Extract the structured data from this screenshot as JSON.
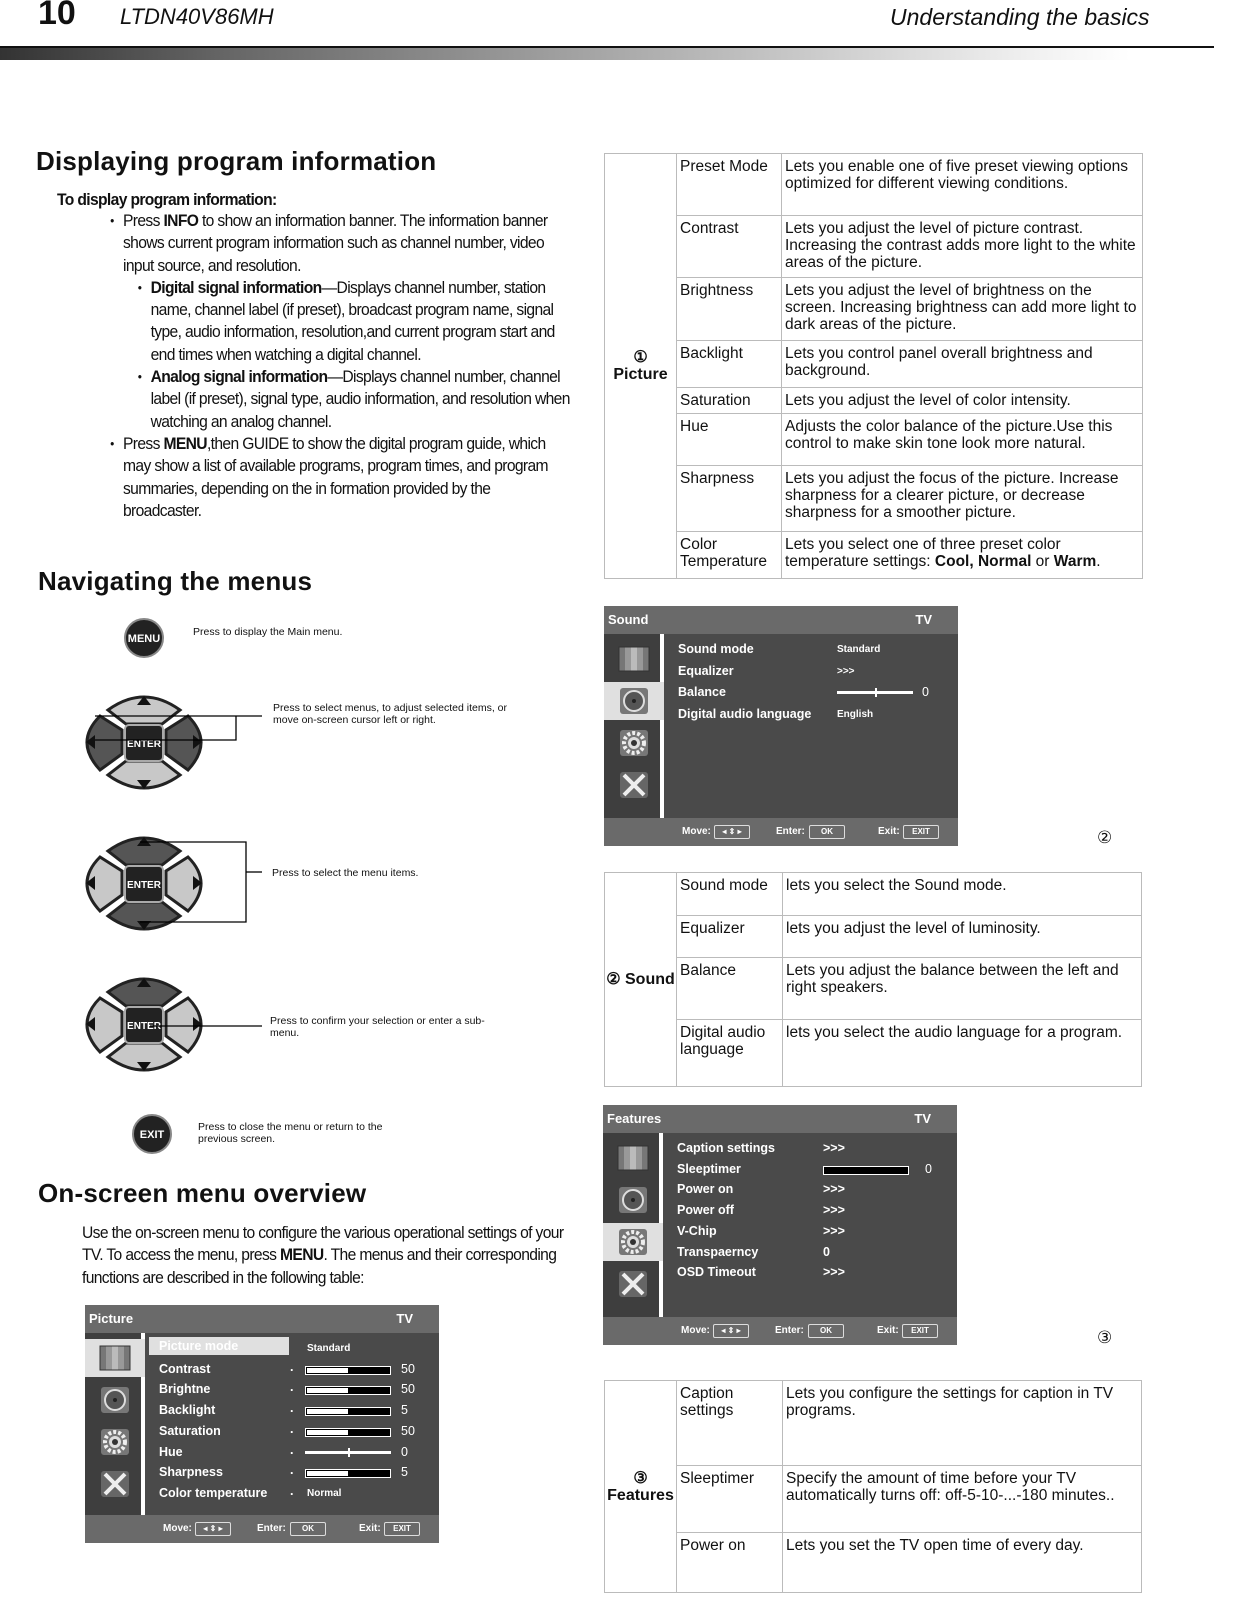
{
  "header": {
    "page_number": "10",
    "model": "LTDN40V86MH",
    "section": "Understanding the basics"
  },
  "display_info": {
    "title": "Displaying program information",
    "subtitle": "To display program information:",
    "bullets": [
      {
        "level": 1,
        "parts": [
          "Press ",
          {
            "b": "INFO"
          },
          " to show an information banner. The information banner shows current program information such as channel number, video input source, and resolution."
        ]
      },
      {
        "level": 2,
        "parts": [
          {
            "b": "Digital signal information"
          },
          "—Displays channel number, station name, channel label (if preset), broadcast program name, signal type, audio information, resolution,and current program start and end times when watching a digital channel."
        ]
      },
      {
        "level": 2,
        "parts": [
          {
            "b": "Analog signal information"
          },
          "—Displays channel number, channel label (if preset), signal type, audio information, and resolution when watching an analog channel."
        ]
      },
      {
        "level": 1,
        "parts": [
          "Press ",
          {
            "b": "MENU"
          },
          ",then GUIDE  to show the digital program guide, which may show a list of available programs, program times, and program summaries, depending on the in  formation provided by the broadcaster."
        ]
      }
    ]
  },
  "navigating": {
    "title": "Navigating the menus",
    "menu_btn": "MENU",
    "enter_btn": "ENTER",
    "exit_btn": "EXIT",
    "callouts": [
      "Press to display the Main menu.",
      "Press to select menus, to adjust selected items, or move on-screen cursor left or right.",
      "Press to select the menu items.",
      "Press to confirm your selection or enter a sub-menu.",
      "Press to close the menu or return to the previous screen."
    ]
  },
  "overview": {
    "title": "On-screen menu overview",
    "intro": [
      "Use the on-screen menu to configure the various operational settings of your TV. To access the menu, press ",
      {
        "b": "MENU"
      },
      ". The menus and their corresponding functions are described in the following table:"
    ]
  },
  "osd_common": {
    "tv": "TV",
    "move": "Move:",
    "enter": "Enter:",
    "exit": "Exit:",
    "move_key": "◂ ⇕ ▸",
    "ok_key": "OK",
    "exit_key": "EXIT"
  },
  "osd_picture": {
    "title": "Picture",
    "selected_index": 0,
    "rows": [
      {
        "label": "Picture mode",
        "value": "Standard"
      },
      {
        "label": "Contrast",
        "value": "50",
        "bar": 0.5
      },
      {
        "label": "Brightne",
        "value": "50",
        "bar": 0.5
      },
      {
        "label": "Backlight",
        "value": "5",
        "bar": 0.5
      },
      {
        "label": "Saturation",
        "value": "50",
        "bar": 0.5
      },
      {
        "label": "Hue",
        "value": "0",
        "slider": 0.5
      },
      {
        "label": "Sharpness",
        "value": "5",
        "bar": 0.5
      },
      {
        "label": "Color temperature",
        "value": "Normal"
      }
    ]
  },
  "osd_sound": {
    "title": "Sound",
    "selected_icon": 1,
    "rows": [
      {
        "label": "Sound mode",
        "value": "Standard"
      },
      {
        "label": "Equalizer",
        "value": ">>>"
      },
      {
        "label": "Balance",
        "value": "0",
        "slider": 0.5
      },
      {
        "label": "Digital audio language",
        "value": "English"
      }
    ]
  },
  "osd_features": {
    "title": "Features",
    "selected_icon": 2,
    "rows": [
      {
        "label": "Caption settings",
        "value": ">>>"
      },
      {
        "label": "Sleeptimer",
        "value": "0",
        "bar": 0
      },
      {
        "label": "Power on",
        "value": ">>>"
      },
      {
        "label": "Power off",
        "value": ">>>"
      },
      {
        "label": "V-Chip",
        "value": ">>>"
      },
      {
        "label": "Transpaerncy",
        "value": "0"
      },
      {
        "label": "OSD Timeout",
        "value": ">>>"
      }
    ]
  },
  "markers": {
    "sound": "②",
    "features": "③"
  },
  "table_picture": {
    "group": "① Picture",
    "rows": [
      {
        "item": "Preset  Mode",
        "desc": [
          "Lets you enable one of five preset viewing options optimized for different viewing conditions."
        ]
      },
      {
        "item": "Contrast",
        "desc": [
          "Lets you adjust the level of picture contrast. Increasing the contrast adds more light to the white areas of the picture."
        ]
      },
      {
        "item": "Brightness",
        "desc": [
          "Lets you adjust the level of brightness on the screen. Increasing brightness can add more light to dark areas of the picture."
        ]
      },
      {
        "item": "Backlight",
        "desc": [
          "Lets you control panel overall brightness and background."
        ]
      },
      {
        "item": "Saturation",
        "desc": [
          "Lets you adjust the level of color intensity."
        ]
      },
      {
        "item": "Hue",
        "desc": [
          "Adjusts the color balance of the picture.Use this control to make skin tone look more natural."
        ]
      },
      {
        "item": "Sharpness",
        "desc": [
          "Lets you adjust the focus of the picture. Increase sharpness for a clearer picture, or decrease sharpness for a smoother picture."
        ]
      },
      {
        "item": "Color Temperature",
        "desc": [
          "Lets you select one of three preset color temperature settings: ",
          {
            "b": "Cool, Normal"
          },
          " or ",
          {
            "b": "Warm"
          },
          "."
        ]
      }
    ]
  },
  "table_sound": {
    "group": "② Sound",
    "rows": [
      {
        "item": "Sound mode",
        "desc": [
          "lets you select the Sound mode."
        ]
      },
      {
        "item": "Equalizer",
        "desc": [
          "lets you adjust the level of luminosity."
        ]
      },
      {
        "item": "Balance",
        "desc": [
          "Lets you adjust the balance between the left and right speakers."
        ]
      },
      {
        "item": "Digital audio language",
        "desc": [
          "lets you select the audio language for a program."
        ]
      }
    ]
  },
  "table_features": {
    "group": "③ Features",
    "rows": [
      {
        "item": "Caption settings",
        "desc": [
          "Lets you configure the settings for caption in TV programs."
        ]
      },
      {
        "item": "Sleeptimer",
        "desc": [
          "Specify the amount of time before your TV automatically turns off: off-5-10-...-180 minutes.."
        ]
      },
      {
        "item": "Power on",
        "desc": [
          "Lets you  set the TV open time of every day."
        ]
      }
    ]
  }
}
